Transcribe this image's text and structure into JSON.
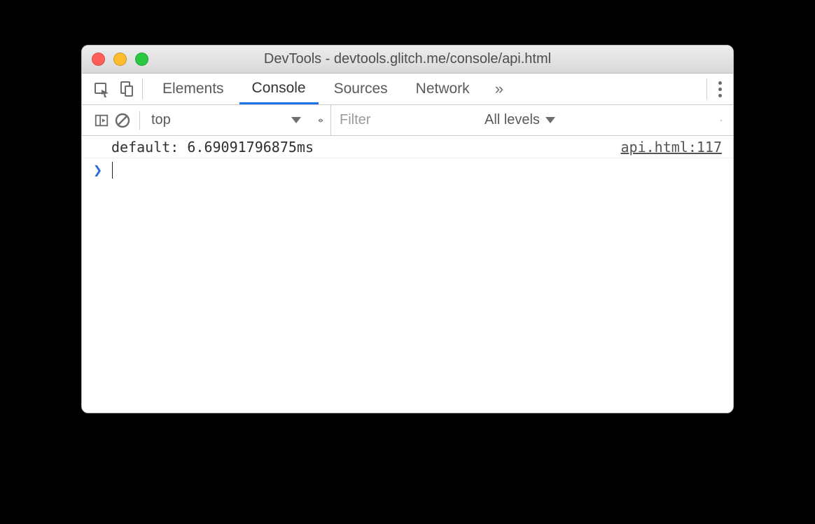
{
  "window": {
    "title": "DevTools - devtools.glitch.me/console/api.html"
  },
  "tabs": {
    "elements": "Elements",
    "console": "Console",
    "sources": "Sources",
    "network": "Network",
    "more_glyph": "»"
  },
  "filterbar": {
    "context": "top",
    "filter_placeholder": "Filter",
    "levels_label": "All levels"
  },
  "console": {
    "entries": [
      {
        "message": "default: 6.69091796875ms",
        "source": "api.html:117"
      }
    ],
    "prompt_glyph": "❯"
  }
}
